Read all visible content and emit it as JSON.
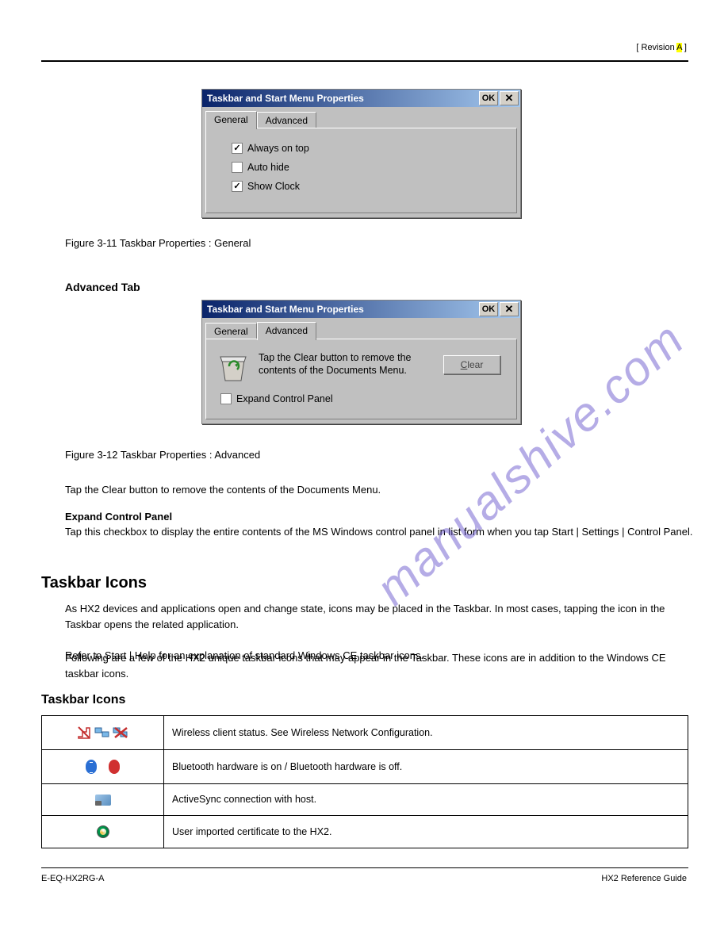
{
  "header": {
    "rev_label": "Revision",
    "rev_value": "A"
  },
  "dialog1": {
    "title": "Taskbar and Start Menu Properties",
    "ok": "OK",
    "tabs": {
      "general": "General",
      "advanced": "Advanced"
    },
    "opts": {
      "always_on_top": "Always on top",
      "auto_hide": "Auto hide",
      "show_clock": "Show Clock"
    }
  },
  "caption1": "Figure 3-11 Taskbar Properties : General",
  "section_advanced_tab": "Advanced Tab",
  "dialog2": {
    "title": "Taskbar and Start Menu Properties",
    "ok": "OK",
    "tabs": {
      "general": "General",
      "advanced": "Advanced"
    },
    "msg": "Tap the Clear button to remove the contents of the Documents Menu.",
    "clear": "Clear",
    "expand": "Expand Control Panel"
  },
  "caption2": "Figure 3-12 Taskbar Properties : Advanced",
  "body_clear": "Tap the Clear button to remove the contents of the Documents Menu.",
  "body_expand_head": "Expand Control Panel",
  "body_expand": "Tap this checkbox to display the entire contents of the MS Windows control panel in list form when you tap Start | Settings | Control Panel.",
  "section_heading": "Taskbar Icons",
  "body_taskbar1": "As HX2 devices and applications open and change state, icons may be placed in the Taskbar. In most cases, tapping the icon in the Taskbar opens the related application.",
  "body_taskbar2": "Refer to Start | Help for an explanation of standard Windows CE taskbar icons.",
  "body_taskbar3": "Following are a few of the HX2 unique taskbar icons that may appear in the Taskbar. These icons are in addition to the Windows CE taskbar icons.",
  "section_taskbar_icons": "Taskbar Icons",
  "table": {
    "row1": "Wireless client status. See Wireless Network Configuration.",
    "row2": "Bluetooth hardware is on / Bluetooth hardware is off.",
    "row3": "ActiveSync connection with host.",
    "row4": "User imported certificate to the HX2."
  },
  "footer": {
    "left": "E-EQ-HX2RG-A",
    "right": "HX2 Reference Guide"
  },
  "watermark": "manualshive.com"
}
